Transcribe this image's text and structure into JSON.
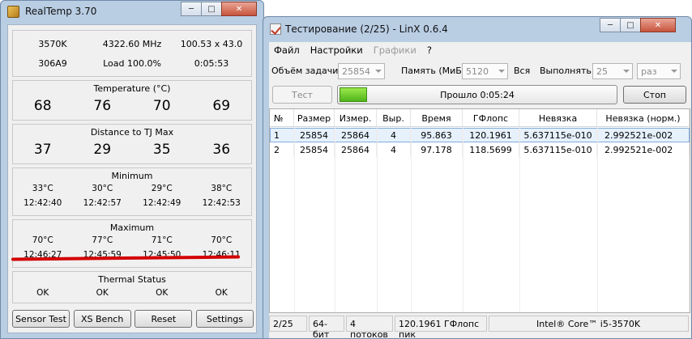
{
  "realtemp": {
    "title": "RealTemp 3.70",
    "info": {
      "cpu": "3570K",
      "mhz": "4322.60 MHz",
      "bus": "100.53 x 43.0",
      "cpuid": "306A9",
      "load": "Load 100.0%",
      "time": "0:05:53"
    },
    "temperature": {
      "title": "Temperature (°C)",
      "values": [
        "68",
        "76",
        "70",
        "69"
      ]
    },
    "distance": {
      "title": "Distance to TJ Max",
      "values": [
        "37",
        "29",
        "35",
        "36"
      ]
    },
    "minimum": {
      "title": "Minimum",
      "temps": [
        "33°C",
        "30°C",
        "29°C",
        "38°C"
      ],
      "times": [
        "12:42:40",
        "12:42:57",
        "12:42:49",
        "12:42:53"
      ]
    },
    "maximum": {
      "title": "Maximum",
      "temps": [
        "70°C",
        "77°C",
        "71°C",
        "70°C"
      ],
      "times": [
        "12:46:27",
        "12:45:59",
        "12:45:50",
        "12:46:11"
      ]
    },
    "thermal": {
      "title": "Thermal Status",
      "values": [
        "OK",
        "OK",
        "OK",
        "OK"
      ]
    },
    "buttons": {
      "sensor_test": "Sensor Test",
      "xs_bench": "XS Bench",
      "reset": "Reset",
      "settings": "Settings"
    }
  },
  "linx": {
    "title": "Тестирование (2/25) - LinX 0.6.4",
    "menu": {
      "file": "Файл",
      "settings": "Настройки",
      "graphs": "Графики",
      "help": "?"
    },
    "params": {
      "task_label": "Объём задачи:",
      "task_value": "25854",
      "memory_label": "Память (МиБ):",
      "memory_value": "5120",
      "all_label": "Вся",
      "run_label": "Выполнять:",
      "run_value": "25",
      "run_unit": "раз"
    },
    "buttons": {
      "test": "Тест",
      "stop": "Стоп"
    },
    "progress": {
      "text": "Прошло 0:05:24",
      "fraction": 0.1
    },
    "table": {
      "headers": [
        "№",
        "Размер",
        "Измер.",
        "Выр.",
        "Время",
        "ГФлопс",
        "Невязка",
        "Невязка (норм.)"
      ],
      "rows": [
        [
          "1",
          "25854",
          "25864",
          "4",
          "95.863",
          "120.1961",
          "5.637115e-010",
          "2.992521e-002"
        ],
        [
          "2",
          "25854",
          "25864",
          "4",
          "97.178",
          "118.5699",
          "5.637115e-010",
          "2.992521e-002"
        ]
      ]
    },
    "status": [
      "2/25",
      "64-бит",
      "4 потоков",
      "120.1961 ГФлопс пик",
      "Intel® Core™ i5-3570K"
    ]
  },
  "colors": {
    "progress": "#5fc21f",
    "highlight_line": "#d40000",
    "window_frame": "#b9cde3"
  }
}
